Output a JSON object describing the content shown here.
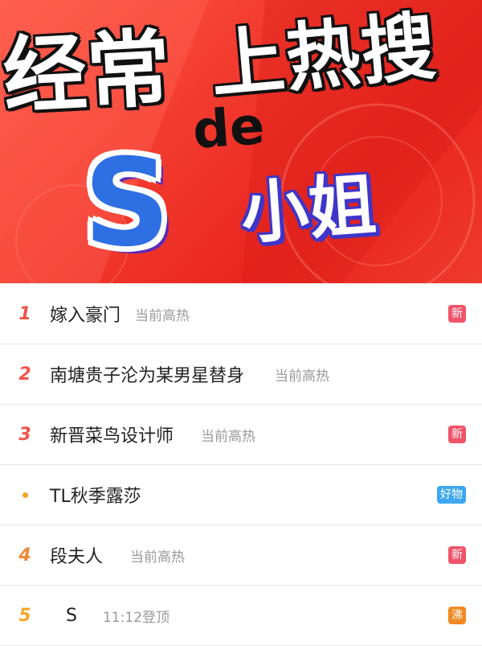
{
  "banner": {
    "line1": "经常",
    "line1b": "上热搜",
    "de": "de",
    "letter": "S",
    "line2": "小姐"
  },
  "colors": {
    "rank_top": "#f0544a",
    "rank_mid": "#f08a3a",
    "rank_low": "#f5a623",
    "badge_new": "#f0546a",
    "badge_good": "#3ea7f2",
    "badge_hot": "#f08a22"
  },
  "list": [
    {
      "rank": "1",
      "name": "嫁入豪门",
      "meta": "当前高热",
      "badge": "新",
      "badge_type": "new"
    },
    {
      "rank": "2",
      "name": "南塘贵子沦为某男星替身",
      "meta": "当前高热",
      "badge": "",
      "badge_type": ""
    },
    {
      "rank": "3",
      "name": "新晋菜鸟设计师",
      "meta": "当前高热",
      "badge": "新",
      "badge_type": "new"
    },
    {
      "rank": "",
      "name": "TL秋季露莎",
      "meta": "",
      "badge": "好物",
      "badge_type": "good"
    },
    {
      "rank": "4",
      "name": "段夫人",
      "meta": "当前高热",
      "badge": "新",
      "badge_type": "new"
    },
    {
      "rank": "5",
      "name": "S",
      "meta": "11:12登顶",
      "badge": "沸",
      "badge_type": "hot"
    }
  ]
}
